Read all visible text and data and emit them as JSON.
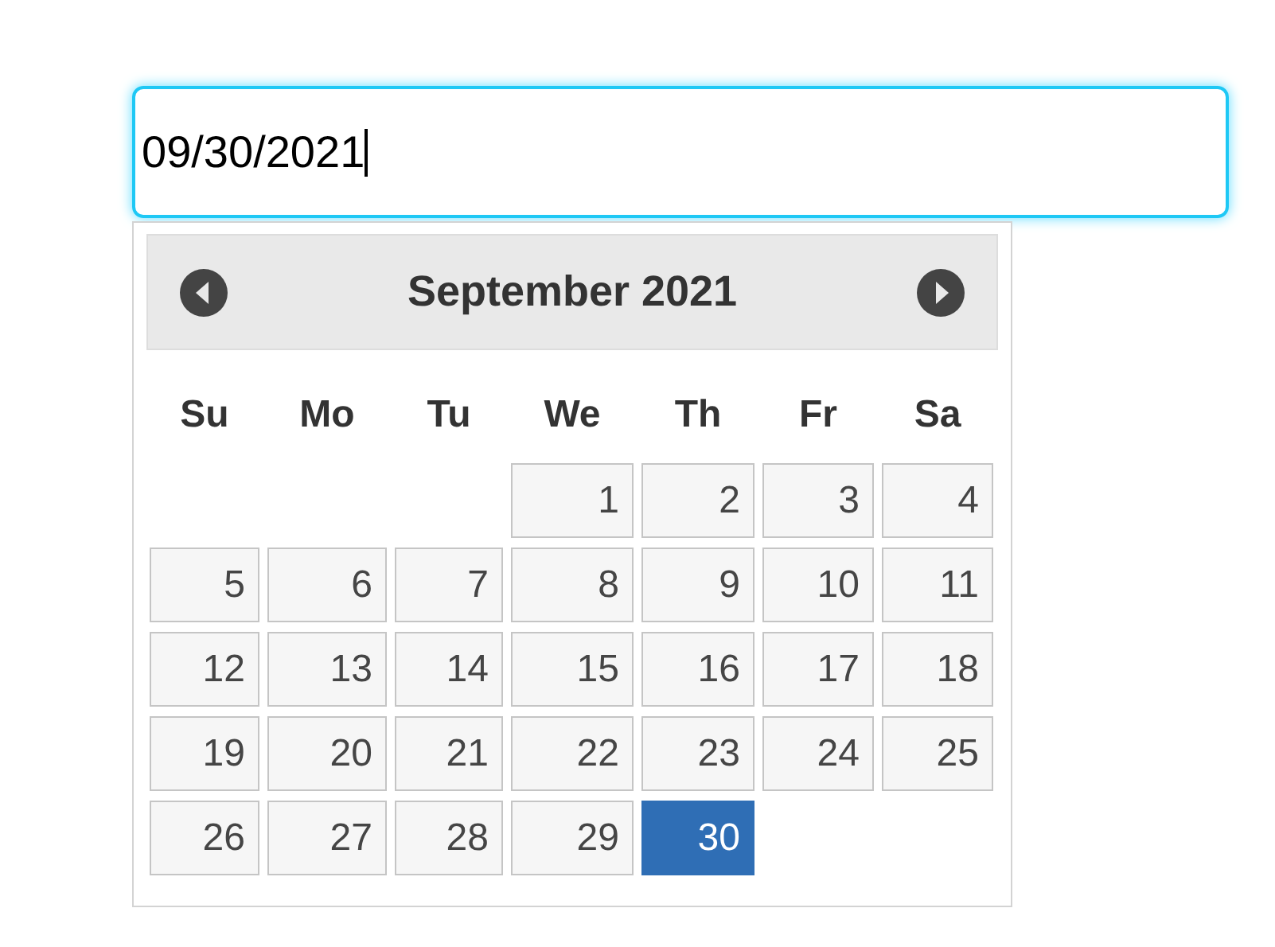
{
  "date_field": {
    "value": "09/30/2021"
  },
  "calendar": {
    "title": "September 2021",
    "weekdays": [
      "Su",
      "Mo",
      "Tu",
      "We",
      "Th",
      "Fr",
      "Sa"
    ],
    "weeks": [
      [
        {
          "label": "1",
          "selected": false
        },
        {
          "label": "2",
          "selected": false
        },
        {
          "label": "3",
          "selected": false
        },
        {
          "label": "4",
          "selected": false
        }
      ],
      [
        {
          "label": "5",
          "selected": false
        },
        {
          "label": "6",
          "selected": false
        },
        {
          "label": "7",
          "selected": false
        },
        {
          "label": "8",
          "selected": false
        },
        {
          "label": "9",
          "selected": false
        },
        {
          "label": "10",
          "selected": false
        },
        {
          "label": "11",
          "selected": false
        }
      ],
      [
        {
          "label": "12",
          "selected": false
        },
        {
          "label": "13",
          "selected": false
        },
        {
          "label": "14",
          "selected": false
        },
        {
          "label": "15",
          "selected": false
        },
        {
          "label": "16",
          "selected": false
        },
        {
          "label": "17",
          "selected": false
        },
        {
          "label": "18",
          "selected": false
        }
      ],
      [
        {
          "label": "19",
          "selected": false
        },
        {
          "label": "20",
          "selected": false
        },
        {
          "label": "21",
          "selected": false
        },
        {
          "label": "22",
          "selected": false
        },
        {
          "label": "23",
          "selected": false
        },
        {
          "label": "24",
          "selected": false
        },
        {
          "label": "25",
          "selected": false
        }
      ],
      [
        {
          "label": "26",
          "selected": false
        },
        {
          "label": "27",
          "selected": false
        },
        {
          "label": "28",
          "selected": false
        },
        {
          "label": "29",
          "selected": false
        },
        {
          "label": "30",
          "selected": true
        }
      ]
    ]
  }
}
